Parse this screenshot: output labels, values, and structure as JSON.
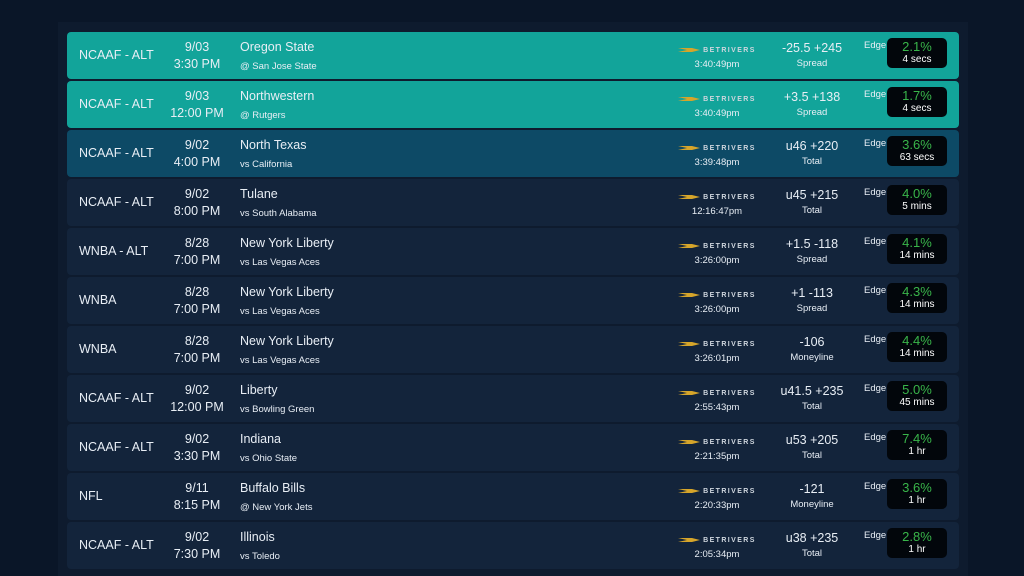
{
  "book_name": "BETRIVERS",
  "edge_label": "Edge",
  "colors": {
    "teal": "#12a49a",
    "dark_blue": "#0d4a66",
    "row": "#13243b",
    "edge_green": "#39b54a",
    "logo_gold": "#d6a52a"
  },
  "rows": [
    {
      "league": "NCAAF - ALT",
      "date": "9/03",
      "time": "3:30 PM",
      "team": "Oregon State",
      "opponent": "@ San Jose State",
      "book_time": "3:40:49pm",
      "odds": "-25.5 +245",
      "bet_type": "Spread",
      "edge": "2.1%",
      "age": "4 secs",
      "highlight": "teal"
    },
    {
      "league": "NCAAF - ALT",
      "date": "9/03",
      "time": "12:00 PM",
      "team": "Northwestern",
      "opponent": "@ Rutgers",
      "book_time": "3:40:49pm",
      "odds": "+3.5 +138",
      "bet_type": "Spread",
      "edge": "1.7%",
      "age": "4 secs",
      "highlight": "teal"
    },
    {
      "league": "NCAAF - ALT",
      "date": "9/02",
      "time": "4:00 PM",
      "team": "North Texas",
      "opponent": "vs California",
      "book_time": "3:39:48pm",
      "odds": "u46 +220",
      "bet_type": "Total",
      "edge": "3.6%",
      "age": "63 secs",
      "highlight": "blue"
    },
    {
      "league": "NCAAF - ALT",
      "date": "9/02",
      "time": "8:00 PM",
      "team": "Tulane",
      "opponent": "vs South Alabama",
      "book_time": "12:16:47pm",
      "odds": "u45 +215",
      "bet_type": "Total",
      "edge": "4.0%",
      "age": "5 mins",
      "highlight": "none"
    },
    {
      "league": "WNBA - ALT",
      "date": "8/28",
      "time": "7:00 PM",
      "team": "New York Liberty",
      "opponent": "vs Las Vegas Aces",
      "book_time": "3:26:00pm",
      "odds": "+1.5 -118",
      "bet_type": "Spread",
      "edge": "4.1%",
      "age": "14 mins",
      "highlight": "none"
    },
    {
      "league": "WNBA",
      "date": "8/28",
      "time": "7:00 PM",
      "team": "New York Liberty",
      "opponent": "vs Las Vegas Aces",
      "book_time": "3:26:00pm",
      "odds": "+1 -113",
      "bet_type": "Spread",
      "edge": "4.3%",
      "age": "14 mins",
      "highlight": "none"
    },
    {
      "league": "WNBA",
      "date": "8/28",
      "time": "7:00 PM",
      "team": "New York Liberty",
      "opponent": "vs Las Vegas Aces",
      "book_time": "3:26:01pm",
      "odds": "-106",
      "bet_type": "Moneyline",
      "edge": "4.4%",
      "age": "14 mins",
      "highlight": "none"
    },
    {
      "league": "NCAAF - ALT",
      "date": "9/02",
      "time": "12:00 PM",
      "team": "Liberty",
      "opponent": "vs Bowling Green",
      "book_time": "2:55:43pm",
      "odds": "u41.5 +235",
      "bet_type": "Total",
      "edge": "5.0%",
      "age": "45 mins",
      "highlight": "none"
    },
    {
      "league": "NCAAF - ALT",
      "date": "9/02",
      "time": "3:30 PM",
      "team": "Indiana",
      "opponent": "vs Ohio State",
      "book_time": "2:21:35pm",
      "odds": "u53 +205",
      "bet_type": "Total",
      "edge": "7.4%",
      "age": "1 hr",
      "highlight": "none"
    },
    {
      "league": "NFL",
      "date": "9/11",
      "time": "8:15 PM",
      "team": "Buffalo Bills",
      "opponent": "@ New York Jets",
      "book_time": "2:20:33pm",
      "odds": "-121",
      "bet_type": "Moneyline",
      "edge": "3.6%",
      "age": "1 hr",
      "highlight": "none"
    },
    {
      "league": "NCAAF - ALT",
      "date": "9/02",
      "time": "7:30 PM",
      "team": "Illinois",
      "opponent": "vs Toledo",
      "book_time": "2:05:34pm",
      "odds": "u38 +235",
      "bet_type": "Total",
      "edge": "2.8%",
      "age": "1 hr",
      "highlight": "none"
    }
  ]
}
